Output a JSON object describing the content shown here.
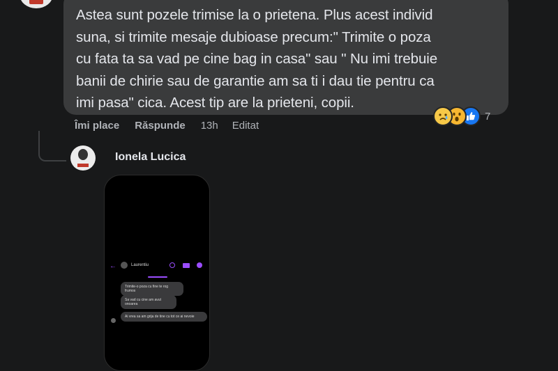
{
  "comment": {
    "text": "Astea sunt pozele trimise la o prietena. Plus acest individ suna, si trimite mesaje dubioase precum:\" Trimite o poza cu fata ta sa vad pe cine bag in casa\" sau \" Nu imi trebuie banii de chirie sau de garantie am sa ti i dau tie pentru ca imi pasa\" cica. Acest tip are la prieteni, copii.",
    "lines": [
      "Astea sunt pozele trimise la o prietena. Plus acest individ",
      "suna, si trimite mesaje dubioase precum:\" Trimite o poza",
      "cu fata ta sa vad pe cine bag in casa\" sau \" Nu imi trebuie",
      "banii de chirie sau de garantie am sa ti i dau tie pentru ca",
      "imi pasa\" cica. Acest tip are la prieteni, copii."
    ],
    "reactions": {
      "icons": [
        "sad-reaction-icon",
        "wow-reaction-icon",
        "like-reaction-icon"
      ],
      "count": "7"
    },
    "actions": {
      "like": "Îmi place",
      "reply": "Răspunde",
      "time": "13h",
      "edited": "Editat"
    }
  },
  "reply": {
    "author": "Ionela Lucica",
    "screenshot": {
      "contact_name": "Laurentiu",
      "messages": [
        "Trimite-o poza cu fine te rog frumos",
        "Sa vad cu cine am avut onoarea",
        "Ai vrea sa am grija de tine cu tot ce ai nevoie"
      ]
    }
  },
  "colors": {
    "background": "#18191a",
    "bubble": "#3a3b3c",
    "text": "#e4e6eb",
    "secondary_text": "#b0b3b8",
    "messenger_accent": "#9b4dff",
    "like_blue": "#1877f2"
  }
}
